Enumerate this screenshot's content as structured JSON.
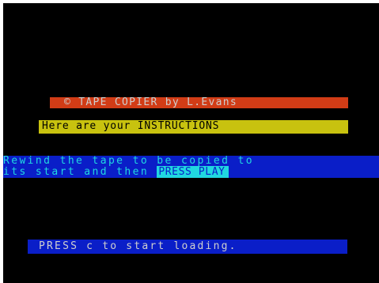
{
  "screen": {
    "border_color": "#ffffff",
    "paper_color": "#000000"
  },
  "title": {
    "text": "© TAPE COPIER by L.Evans",
    "background": "#d13c16",
    "ink": "#cfcfcf"
  },
  "subtitle": {
    "text": "Here are your INSTRUCTIONS",
    "background": "#c8c20f",
    "ink": "#000000"
  },
  "instructions": {
    "line1": "Rewind the tape to be copied to",
    "line2_prefix": "its start and then ",
    "press_play": "PRESS PLAY",
    "background": "#0a1ec8",
    "ink": "#20d7e0"
  },
  "prompt": {
    "text": "PRESS c to start loading.",
    "background": "#0a1ec8",
    "ink": "#cfcfcf"
  }
}
